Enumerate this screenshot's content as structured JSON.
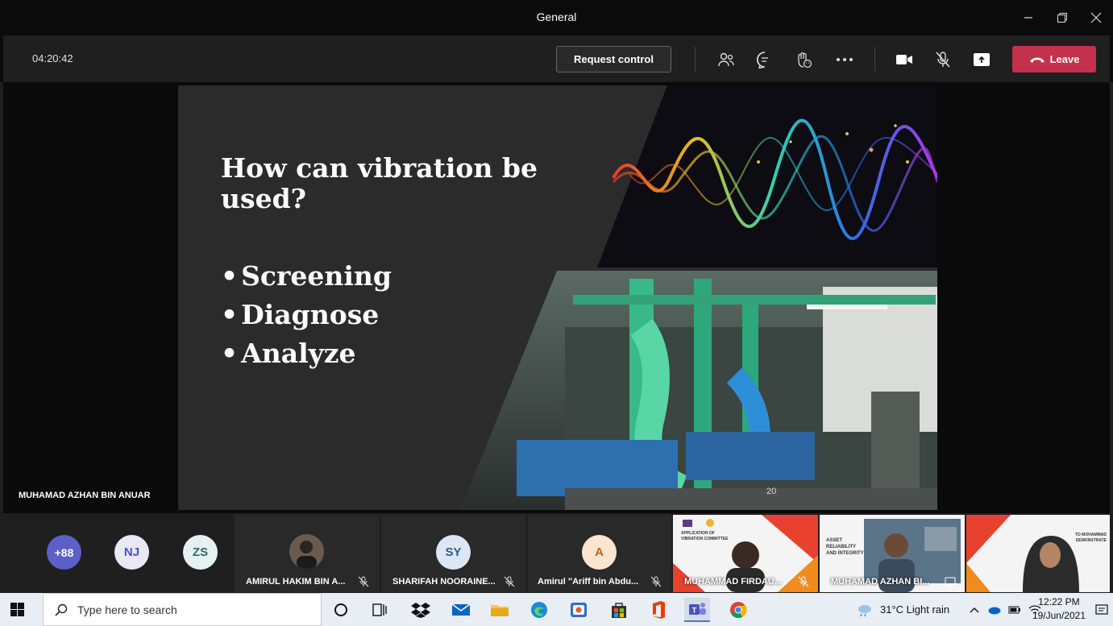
{
  "window": {
    "title": "General"
  },
  "toolbar": {
    "timer": "04:20:42",
    "request_control_label": "Request control",
    "leave_label": "Leave",
    "leave_color": "#c4314b"
  },
  "presenter": {
    "name": "MUHAMAD AZHAN BIN ANUAR"
  },
  "slide": {
    "title": "How can vibration be used?",
    "bullets": [
      "Screening",
      "Diagnose",
      "Analyze"
    ],
    "page_number": "20"
  },
  "participants": {
    "overflow_count": "+88",
    "initials": [
      {
        "initials": "NJ",
        "bg": "#e9e9f5",
        "fg": "#4b53bc"
      },
      {
        "initials": "ZS",
        "bg": "#e6f1f1",
        "fg": "#2e6b6b"
      }
    ],
    "tiles": [
      {
        "name": "AMIRUL HAKIM BIN A...",
        "avatar": "photo"
      },
      {
        "name": "SHARIFAH NOORAINE...",
        "avatar": "SY"
      },
      {
        "name": "Amirul \"Ariff bin Abdu...",
        "avatar": "A"
      }
    ],
    "videos": [
      {
        "name": "MUHAMMAD FIRDAU...",
        "caption": "APPLICATION OF VIBRATION COMMITTEE"
      },
      {
        "name": "MUHAMAD AZHAN BI...",
        "caption": "ASSET RELIABILITY AND INTEGRITY"
      },
      {
        "name": "",
        "caption": "TO MOHAMMAD DEMONSTRATE"
      }
    ]
  },
  "taskbar": {
    "search_placeholder": "Type here to search",
    "weather": "31°C  Light rain",
    "time": "12:22 PM",
    "date": "19/Jun/2021"
  }
}
